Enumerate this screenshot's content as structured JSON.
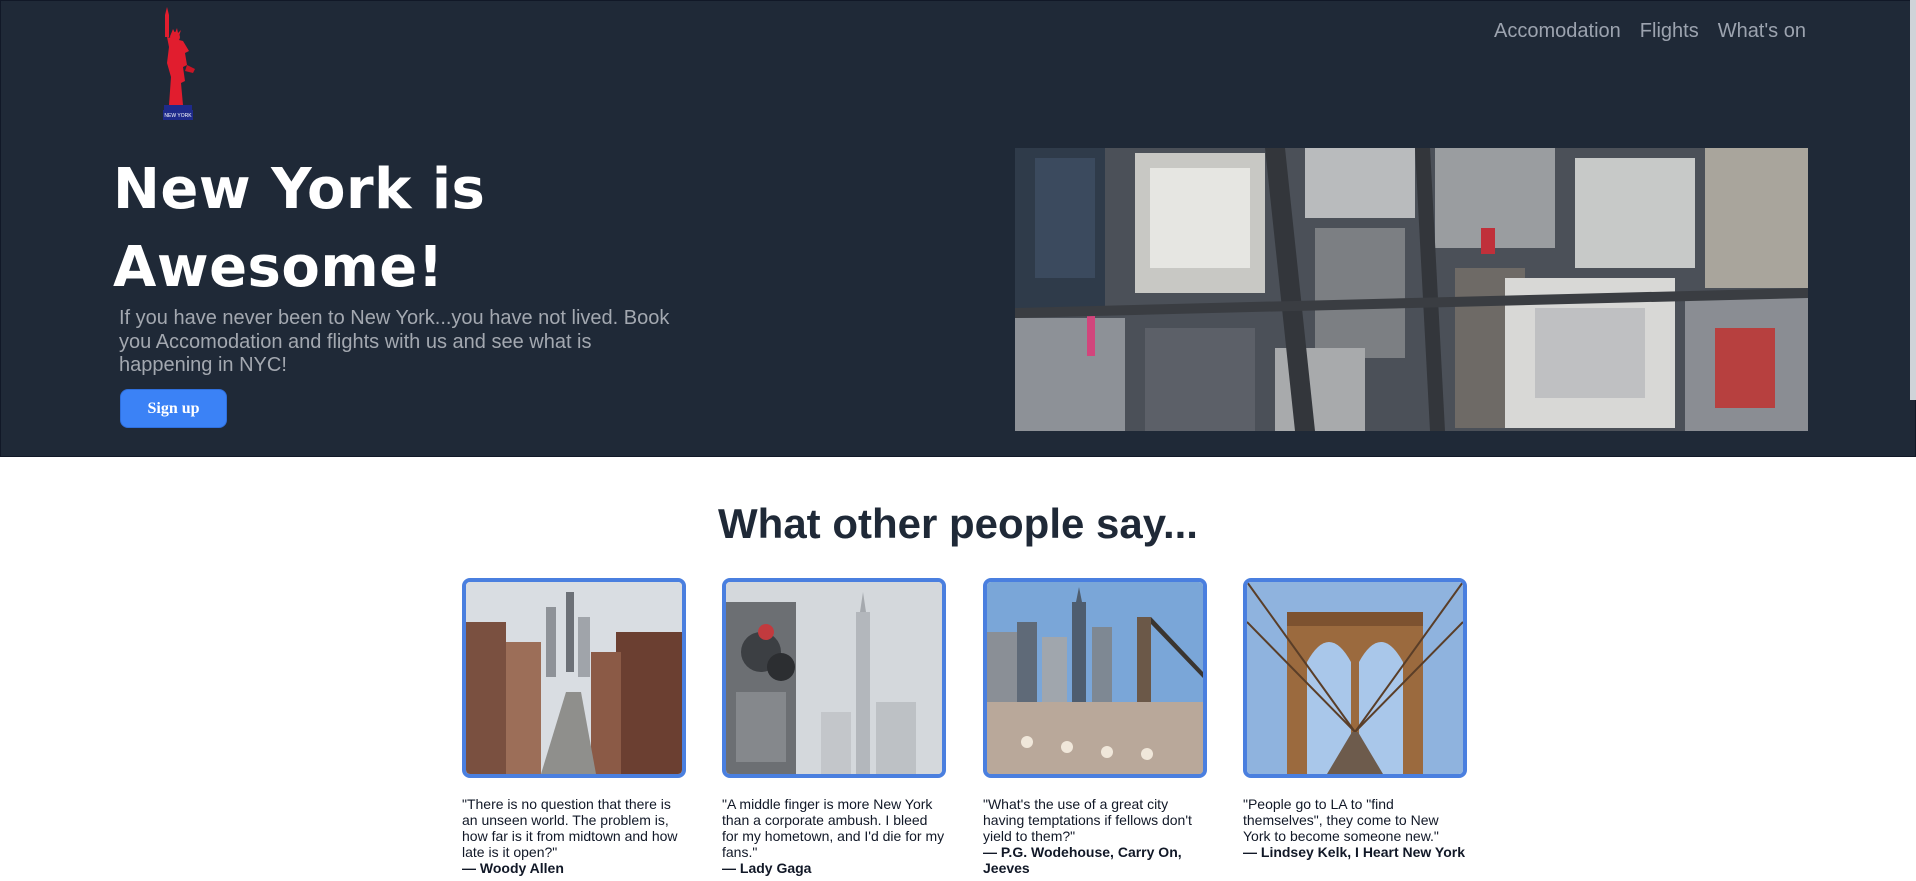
{
  "nav": {
    "links": [
      "Accomodation",
      "Flights",
      "What's on"
    ]
  },
  "hero": {
    "headline_line1": "New York is",
    "headline_line2": "Awesome!",
    "lead": "If you have never been to New York...you have not lived. Book you Accomodation and flights with us and see what is happening in NYC!",
    "signup_label": "Sign up",
    "logo_icon": "statue-of-liberty-icon",
    "logo_text": "NEW YORK"
  },
  "testimonials": {
    "title": "What other people say...",
    "items": [
      {
        "quote": "\"There is no question that there is an unseen world. The problem is, how far is it from midtown and how late is it open?\"",
        "author": "— Woody Allen"
      },
      {
        "quote": "\"A middle finger is more New York than a corporate ambush. I bleed for my hometown, and I'd die for my fans.\"",
        "author": "— Lady Gaga"
      },
      {
        "quote": "\"What's the use of a great city having temptations if fellows don't yield to them?\"",
        "author": "— P.G. Wodehouse, Carry On, Jeeves"
      },
      {
        "quote": "\"People go to LA to \"find themselves\", they come to New York to become someone new.\"",
        "author": "— Lindsey Kelk, I Heart New York"
      }
    ]
  },
  "colors": {
    "hero_bg": "#1f2937",
    "accent": "#3b82f6",
    "card_border": "#4a7fdf"
  }
}
